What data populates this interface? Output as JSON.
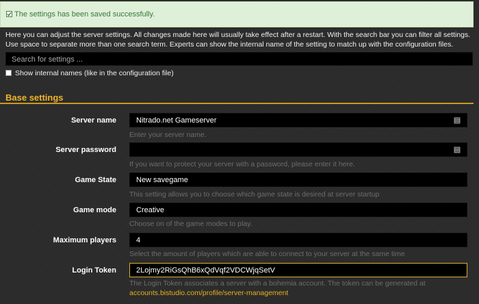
{
  "success_message": "The settings has been saved successfully.",
  "intro_text": "Here you can adjust the server settings. All changes made here will usually take effect after a restart. With the search bar you can filter all settings. Use space to separate more than one search term. Experts can show the internal name of the setting to match up with the configuration files.",
  "search": {
    "placeholder": "Search for settings ..."
  },
  "show_internal_label": "Show internal names (like in the configuration file)",
  "section_title": "Base settings",
  "settings": [
    {
      "label": "Server name",
      "value": "Nitrado.net Gameserver",
      "help": "Enter your server name.",
      "icon": "document-icon"
    },
    {
      "label": "Server password",
      "value": "",
      "help": "If you want to protect your server with a password, please enter it here.",
      "icon": "document-icon"
    },
    {
      "label": "Game State",
      "value": "New savegame",
      "help": "This setting allows you to choose which game state is desired at server startup"
    },
    {
      "label": "Game mode",
      "value": "Creative",
      "help": "Choose on of the game modes to play."
    },
    {
      "label": "Maximum players",
      "value": "4",
      "help": "Select the amount of players which are able to connect to your server at the same time"
    },
    {
      "label": "Login Token",
      "value": "2Lojmy2RiGsQhB6xQdVqf2VDCWjqSetV",
      "help": "The Login Token associates a server with a bohemia account. The token can be generated at",
      "link": "accounts.bistudio.com/profile/server-management"
    }
  ],
  "colors": {
    "accent": "#f0b429",
    "success_bg": "#dff0d8",
    "success_text": "#3c763d"
  }
}
